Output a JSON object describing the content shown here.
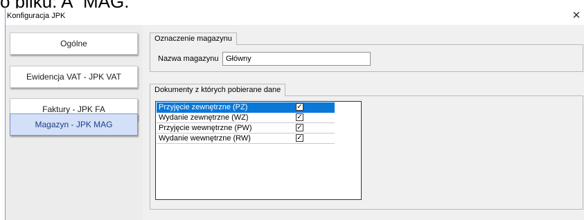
{
  "overlay_fragment": "o pliku: A_MAG.",
  "window": {
    "title": "Konfiguracja JPK",
    "close_glyph": "✕"
  },
  "sidebar": {
    "items": [
      {
        "label": "Ogólne",
        "active": false
      },
      {
        "label": "Ewidencja VAT - JPK VAT",
        "active": false
      },
      {
        "label": "Faktury - JPK FA",
        "active": false
      },
      {
        "label": "Magazyn - JPK MAG",
        "active": true
      }
    ]
  },
  "warehouse_group": {
    "title": "Oznaczenie magazynu",
    "name_label": "Nazwa magazynu",
    "name_value": "Główny"
  },
  "documents_group": {
    "title": "Dokumenty z których pobierane dane",
    "rows": [
      {
        "label": "Przyjęcie zewnętrzne (PZ)",
        "checked": true,
        "selected": true
      },
      {
        "label": "Wydanie zewnętrzne (WZ)",
        "checked": true,
        "selected": false
      },
      {
        "label": "Przyjęcie wewnętrzne (PW)",
        "checked": true,
        "selected": false
      },
      {
        "label": "Wydanie wewnętrzne (RW)",
        "checked": true,
        "selected": false
      }
    ],
    "check_glyph": "✓"
  },
  "colors": {
    "accent": "#0a78d7",
    "active_nav_bg": "#d3e0f8",
    "active_nav_text": "#1f3d85"
  }
}
